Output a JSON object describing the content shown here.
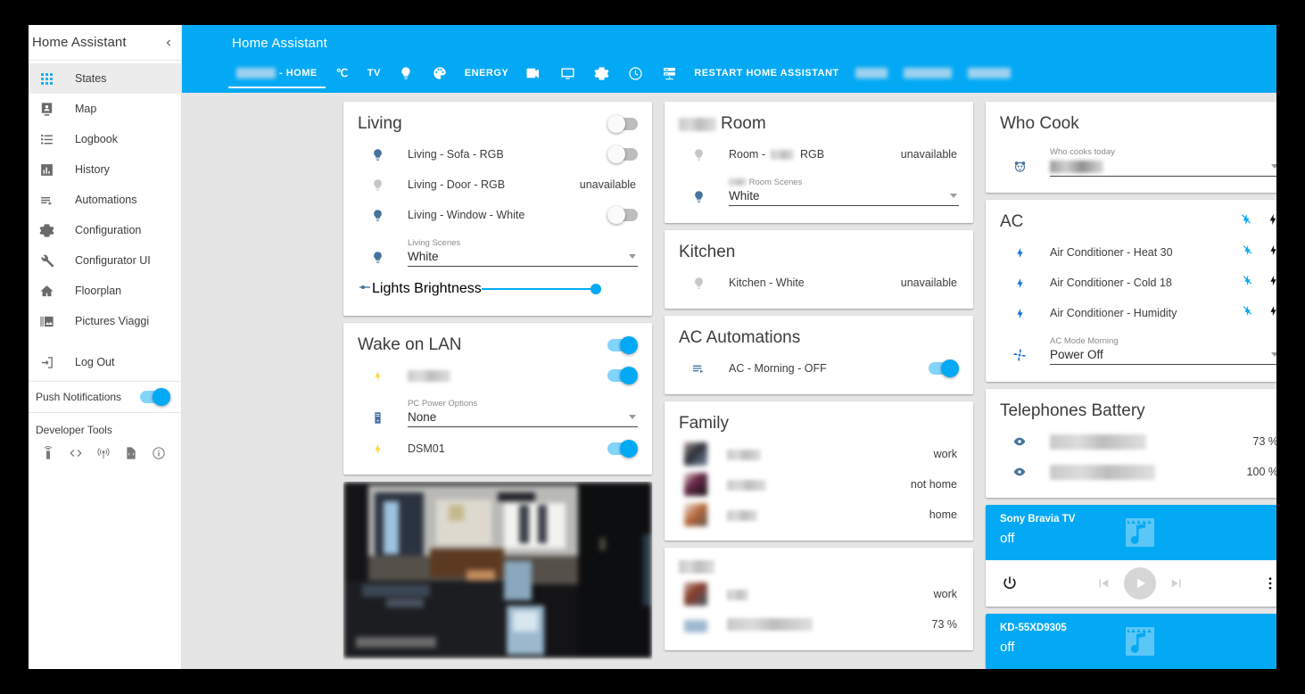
{
  "sidebar": {
    "title": "Home Assistant",
    "collapse_icon": "chevron-left-icon",
    "items": [
      {
        "label": "States",
        "icon": "grid-icon",
        "active": true
      },
      {
        "label": "Map",
        "icon": "map-marker-account-icon",
        "active": false
      },
      {
        "label": "Logbook",
        "icon": "format-list-icon",
        "active": false
      },
      {
        "label": "History",
        "icon": "chart-box-icon",
        "active": false
      },
      {
        "label": "Automations",
        "icon": "playlist-play-icon",
        "active": false
      },
      {
        "label": "Configuration",
        "icon": "gear-icon",
        "active": false
      },
      {
        "label": "Configurator UI",
        "icon": "wrench-icon",
        "active": false
      },
      {
        "label": "Floorplan",
        "icon": "home-icon",
        "active": false
      },
      {
        "label": "Pictures Viaggi",
        "icon": "image-multiple-icon",
        "active": false
      },
      {
        "label": "Log Out",
        "icon": "logout-icon",
        "active": false
      }
    ],
    "push_notifications": {
      "label": "Push Notifications",
      "on": true
    },
    "developer_tools": {
      "label": "Developer Tools",
      "icons": [
        "remote-icon",
        "code-tags-icon",
        "broadcast-icon",
        "file-code-icon",
        "information-icon"
      ]
    }
  },
  "header": {
    "title": "Home Assistant",
    "accent_color": "#03a9f4",
    "tabs": [
      {
        "label": "- HOME",
        "icon": "",
        "type": "text",
        "active": true,
        "blurred_prefix": true
      },
      {
        "label": "",
        "icon": "temperature-icon",
        "type": "icon",
        "active": false
      },
      {
        "label": "TV",
        "icon": "",
        "type": "text",
        "active": false
      },
      {
        "label": "",
        "icon": "lightbulb-icon",
        "type": "icon",
        "active": false
      },
      {
        "label": "",
        "icon": "palette-icon",
        "type": "icon",
        "active": false
      },
      {
        "label": "ENERGY",
        "icon": "",
        "type": "text",
        "active": false
      },
      {
        "label": "",
        "icon": "video-icon",
        "type": "icon",
        "active": false
      },
      {
        "label": "",
        "icon": "monitor-icon",
        "type": "icon",
        "active": false
      },
      {
        "label": "",
        "icon": "gear-icon",
        "type": "icon",
        "active": false
      },
      {
        "label": "",
        "icon": "clock-icon",
        "type": "icon",
        "active": false
      },
      {
        "label": "",
        "icon": "server-icon",
        "type": "icon",
        "active": false
      },
      {
        "label": "RESTART HOME ASSISTANT",
        "icon": "",
        "type": "text",
        "active": false
      },
      {
        "label": "",
        "icon": "",
        "type": "blurred",
        "active": false
      },
      {
        "label": "",
        "icon": "",
        "type": "blurred",
        "active": false
      },
      {
        "label": "",
        "icon": "",
        "type": "blurred",
        "active": false
      }
    ]
  },
  "cards": {
    "living": {
      "title": "Living",
      "header_toggle": "off",
      "rows": [
        {
          "name": "Living - Sofa - RGB",
          "icon": "lightbulb-icon",
          "control": "toggle",
          "state": "off"
        },
        {
          "name": "Living - Door - RGB",
          "icon": "lightbulb-off-icon",
          "control": "text",
          "state": "unavailable"
        },
        {
          "name": "Living - Window - White",
          "icon": "lightbulb-icon",
          "control": "toggle",
          "state": "off"
        }
      ],
      "scene": {
        "label": "Living Scenes",
        "value": "White",
        "icon": "lightbulb-icon"
      },
      "slider": {
        "label": "Lights Brightness",
        "icon": "tune-icon",
        "value": 100
      }
    },
    "wake_on_lan": {
      "title": "Wake on LAN",
      "header_toggle": "on",
      "rows": [
        {
          "name": "",
          "blurred": true,
          "icon": "flash-icon",
          "control": "toggle",
          "state": "on"
        }
      ],
      "select": {
        "label": "PC Power Options",
        "value": "None",
        "icon": "desktop-tower-icon"
      },
      "rows2": [
        {
          "name": "DSM01",
          "icon": "flash-icon",
          "control": "toggle",
          "state": "on"
        }
      ]
    },
    "camera": {
      "name": "camera-feed"
    },
    "room": {
      "title": "Room",
      "title_blurred_prefix": true,
      "rows": [
        {
          "name_a": "Room -",
          "name_b": "RGB",
          "blurred_mid": true,
          "icon": "lightbulb-off-icon",
          "control": "text",
          "state": "unavailable"
        }
      ],
      "scene": {
        "label": "Room Scenes",
        "label_blurred_prefix": true,
        "value": "White",
        "icon": "lightbulb-icon"
      }
    },
    "kitchen": {
      "title": "Kitchen",
      "rows": [
        {
          "name": "Kitchen - White",
          "icon": "lightbulb-off-icon",
          "control": "text",
          "state": "unavailable"
        }
      ]
    },
    "ac_automations": {
      "title": "AC Automations",
      "rows": [
        {
          "name": "AC - Morning - OFF",
          "icon": "playlist-play-icon",
          "control": "toggle",
          "state": "on"
        }
      ]
    },
    "family": {
      "title": "Family",
      "rows": [
        {
          "name": "",
          "blurred": true,
          "state": "work"
        },
        {
          "name": "",
          "blurred": true,
          "state": "not home"
        },
        {
          "name": "",
          "blurred": true,
          "state": "home"
        }
      ]
    },
    "family2": {
      "title": "",
      "title_blurred": true,
      "rows": [
        {
          "name": "",
          "blurred": true,
          "state": "work"
        },
        {
          "name": "",
          "blurred": true,
          "state": "73 %"
        }
      ]
    },
    "who_cook": {
      "title": "Who Cook",
      "select": {
        "label": "Who cooks today",
        "value": "",
        "value_blurred": true,
        "icon": "panda-icon"
      }
    },
    "ac": {
      "title": "AC",
      "header_icons": [
        "flash-off-icon",
        "flash-icon"
      ],
      "rows": [
        {
          "name": "Air Conditioner - Heat 30",
          "icon": "flash-icon",
          "control": "dual-flash"
        },
        {
          "name": "Air Conditioner - Cold 18",
          "icon": "flash-icon",
          "control": "dual-flash"
        },
        {
          "name": "Air Conditioner - Humidity",
          "icon": "flash-icon",
          "control": "dual-flash"
        }
      ],
      "select": {
        "label": "AC Mode Morning",
        "value": "Power Off",
        "icon": "fan-icon"
      }
    },
    "telephones_battery": {
      "title": "Telephones Battery",
      "rows": [
        {
          "name": "",
          "blurred": true,
          "icon": "eye-icon",
          "state": "73 %"
        },
        {
          "name": "",
          "blurred": true,
          "icon": "eye-icon",
          "state": "100 %"
        }
      ]
    },
    "media_players": [
      {
        "name": "Sony Bravia TV",
        "state": "off",
        "art_icon": "music-box-icon",
        "controls": {
          "power_icon": "power-icon",
          "prev_icon": "skip-previous-icon",
          "play_icon": "play-icon",
          "next_icon": "skip-next-icon",
          "menu_icon": "dots-vertical-icon"
        },
        "show_controls": true
      },
      {
        "name": "KD-55XD9305",
        "state": "off",
        "art_icon": "music-box-icon",
        "show_controls": false
      }
    ]
  }
}
